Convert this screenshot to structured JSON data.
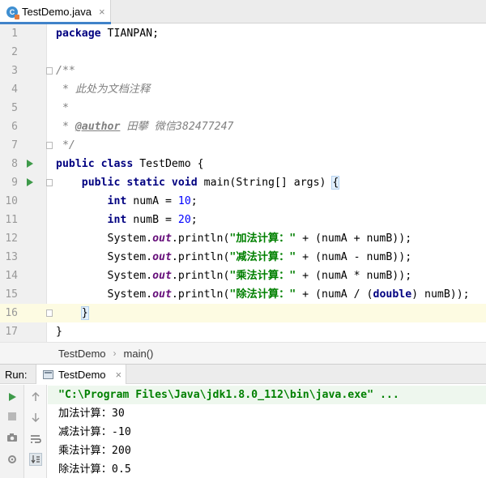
{
  "editor_tab": {
    "label": "TestDemo.java",
    "icon_letter": "C",
    "close": "×"
  },
  "code_lines": [
    {
      "n": "1",
      "tokens": [
        [
          "kw",
          "package"
        ],
        [
          "p",
          " TIANPAN;"
        ]
      ]
    },
    {
      "n": "2",
      "tokens": []
    },
    {
      "n": "3",
      "tokens": [
        [
          "cm",
          "/**"
        ]
      ]
    },
    {
      "n": "4",
      "tokens": [
        [
          "cm",
          " * 此处为文档注释"
        ]
      ]
    },
    {
      "n": "5",
      "tokens": [
        [
          "cm",
          " *"
        ]
      ]
    },
    {
      "n": "6",
      "tokens": [
        [
          "cm",
          " * "
        ],
        [
          "tag",
          "@author"
        ],
        [
          "cm",
          " 田攀 微信382477247"
        ]
      ]
    },
    {
      "n": "7",
      "tokens": [
        [
          "cm",
          " */"
        ]
      ]
    },
    {
      "n": "8",
      "tokens": [
        [
          "kw",
          "public class"
        ],
        [
          "p",
          " TestDemo {"
        ]
      ]
    },
    {
      "n": "9",
      "tokens": [
        [
          "p",
          "    "
        ],
        [
          "kw",
          "public static void"
        ],
        [
          "p",
          " main(String[] args) "
        ],
        [
          "brace",
          "{"
        ]
      ]
    },
    {
      "n": "10",
      "tokens": [
        [
          "p",
          "        "
        ],
        [
          "kw",
          "int"
        ],
        [
          "p",
          " numA = "
        ],
        [
          "num",
          "10"
        ],
        [
          "p",
          ";"
        ]
      ]
    },
    {
      "n": "11",
      "tokens": [
        [
          "p",
          "        "
        ],
        [
          "kw",
          "int"
        ],
        [
          "p",
          " numB = "
        ],
        [
          "num",
          "20"
        ],
        [
          "p",
          ";"
        ]
      ]
    },
    {
      "n": "12",
      "tokens": [
        [
          "p",
          "        System."
        ],
        [
          "fld",
          "out"
        ],
        [
          "p",
          ".println("
        ],
        [
          "str",
          "\"加法计算：\""
        ],
        [
          "p",
          " + (numA + numB));"
        ]
      ]
    },
    {
      "n": "13",
      "tokens": [
        [
          "p",
          "        System."
        ],
        [
          "fld",
          "out"
        ],
        [
          "p",
          ".println("
        ],
        [
          "str",
          "\"减法计算：\""
        ],
        [
          "p",
          " + (numA - numB));"
        ]
      ]
    },
    {
      "n": "14",
      "tokens": [
        [
          "p",
          "        System."
        ],
        [
          "fld",
          "out"
        ],
        [
          "p",
          ".println("
        ],
        [
          "str",
          "\"乘法计算：\""
        ],
        [
          "p",
          " + (numA * numB));"
        ]
      ]
    },
    {
      "n": "15",
      "tokens": [
        [
          "p",
          "        System."
        ],
        [
          "fld",
          "out"
        ],
        [
          "p",
          ".println("
        ],
        [
          "str",
          "\"除法计算：\""
        ],
        [
          "p",
          " + (numA / ("
        ],
        [
          "kw",
          "double"
        ],
        [
          "p",
          ") numB));"
        ]
      ]
    },
    {
      "n": "16",
      "tokens": [
        [
          "p",
          "    "
        ],
        [
          "brace",
          "}"
        ]
      ]
    },
    {
      "n": "17",
      "tokens": [
        [
          "p",
          "}"
        ]
      ]
    }
  ],
  "breadcrumb": {
    "items": [
      "TestDemo",
      "main()"
    ],
    "separator": "›"
  },
  "run_panel": {
    "title": "Run:",
    "tab_label": "TestDemo",
    "tab_close": "×",
    "console_lines": [
      "\"C:\\Program Files\\Java\\jdk1.8.0_112\\bin\\java.exe\" ...",
      "加法计算：30",
      "减法计算：-10",
      "乘法计算：200",
      "除法计算：0.5"
    ]
  },
  "colors": {
    "keyword": "#000080",
    "string": "#008000",
    "number": "#0000ff",
    "comment": "#808080",
    "field": "#660e7a",
    "run_green": "#3e9a4a",
    "tab_underline": "#4083c9"
  }
}
